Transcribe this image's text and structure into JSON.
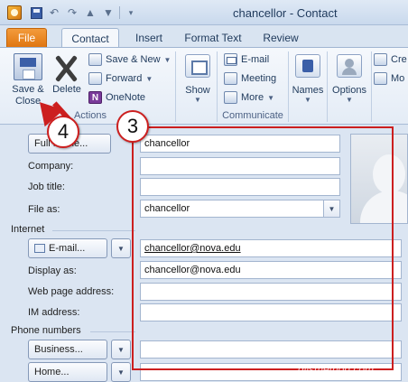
{
  "window": {
    "title": "chancellor  -  Contact"
  },
  "colors": {
    "file_tab": "#e07510",
    "callout_red": "#cc1f1f",
    "ribbon_bg": "#eef3f9"
  },
  "tabs": [
    {
      "label": "File",
      "active": false
    },
    {
      "label": "Contact",
      "active": true
    },
    {
      "label": "Insert",
      "active": false
    },
    {
      "label": "Format Text",
      "active": false
    },
    {
      "label": "Review",
      "active": false
    }
  ],
  "ribbon": {
    "actions": {
      "save_close_label_1": "Save &",
      "save_close_label_2": "Close",
      "delete_label": "Delete",
      "save_new": "Save & New",
      "forward": "Forward",
      "onenote": "OneNote",
      "group_label": "Actions"
    },
    "show": {
      "label": "Show"
    },
    "communicate": {
      "email": "E-mail",
      "meeting": "Meeting",
      "more": "More",
      "group_label": "Communicate"
    },
    "names": {
      "label": "Names"
    },
    "options": {
      "label": "Options"
    },
    "partial": {
      "row1": "Cre",
      "row2": "Mo"
    }
  },
  "callouts": {
    "step4": "4",
    "step3": "3"
  },
  "form": {
    "full_name_button": "Full Name...",
    "full_name_value": "chancellor",
    "company_label": "Company:",
    "company_value": "",
    "job_title_label": "Job title:",
    "job_title_value": "",
    "file_as_label": "File as:",
    "file_as_value": "chancellor",
    "internet_section": "Internet",
    "email_button": "E-mail...",
    "email_value": "chancellor@nova.edu",
    "display_as_label": "Display as:",
    "display_as_value": "chancellor@nova.edu",
    "web_page_label": "Web page address:",
    "web_page_value": "",
    "im_label": "IM address:",
    "im_value": "",
    "phone_section": "Phone numbers",
    "business_button": "Business...",
    "business_value": "",
    "home_button": "Home...",
    "home_value": ""
  },
  "watermark": "gilsmethod.com"
}
